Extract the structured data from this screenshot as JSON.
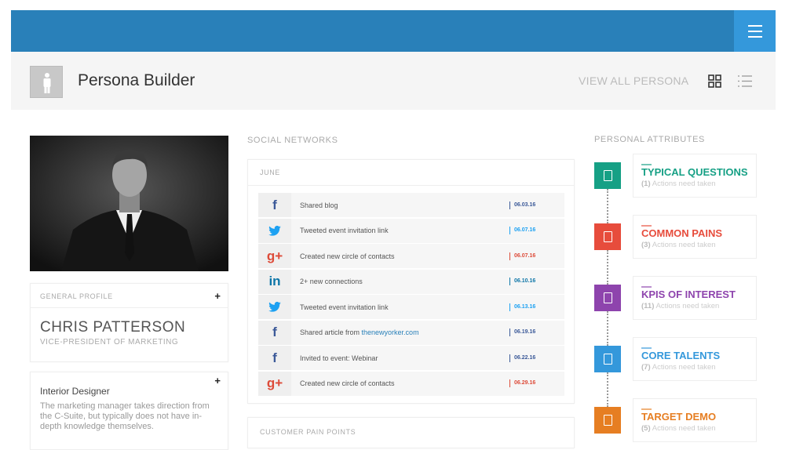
{
  "header": {
    "title": "Persona Builder",
    "view_all": "VIEW ALL PERSONA"
  },
  "profile": {
    "section_label": "GENERAL PROFILE",
    "name": "CHRIS PATTERSON",
    "role": "VICE-PRESIDENT OF MARKETING"
  },
  "description": {
    "title": "Interior Designer",
    "text": "The marketing manager takes direction from the C-Suite, but typically does not have in-depth knowledge themselves."
  },
  "social": {
    "label": "SOCIAL NETWORKS",
    "month": "JUNE",
    "rows": [
      {
        "network": "facebook",
        "text": "Shared blog",
        "date": "06.03.16",
        "color": "#3b5998"
      },
      {
        "network": "twitter",
        "text": "Tweeted event invitation link",
        "date": "06.07.16",
        "color": "#1da1f2"
      },
      {
        "network": "google-plus",
        "text": "Created new circle of contacts",
        "date": "06.07.16",
        "color": "#dd4b39"
      },
      {
        "network": "linkedin",
        "text": "2+ new connections",
        "date": "06.10.16",
        "color": "#0e76a8"
      },
      {
        "network": "twitter",
        "text": "Tweeted event invitation link",
        "date": "06.13.16",
        "color": "#1da1f2"
      },
      {
        "network": "facebook",
        "text": "Shared article from ",
        "link": "thenewyorker.com",
        "date": "06.19.16",
        "color": "#3b5998"
      },
      {
        "network": "facebook",
        "text": "Invited to event: Webinar",
        "date": "06.22.16",
        "color": "#3b5998"
      },
      {
        "network": "google-plus",
        "text": "Created new circle of contacts",
        "date": "06.29.16",
        "color": "#dd4b39"
      }
    ]
  },
  "pain_points": {
    "label": "CUSTOMER PAIN POINTS"
  },
  "attributes": {
    "label": "PERSONAL ATTRIBUTES",
    "items": [
      {
        "title": "TYPICAL QUESTIONS",
        "count": "(1)",
        "sub": " Actions need taken",
        "color": "#16a085"
      },
      {
        "title": "COMMON PAINS",
        "count": "(3)",
        "sub": " Actions need taken",
        "color": "#e74c3c"
      },
      {
        "title": "KPIS OF INTEREST",
        "count": "(11)",
        "sub": " Actions need taken",
        "color": "#8e44ad"
      },
      {
        "title": "CORE TALENTS",
        "count": "(7)",
        "sub": " Actions need taken",
        "color": "#3498db"
      },
      {
        "title": "TARGET DEMO",
        "count": "(5)",
        "sub": " Actions need taken",
        "color": "#e67e22"
      }
    ]
  }
}
